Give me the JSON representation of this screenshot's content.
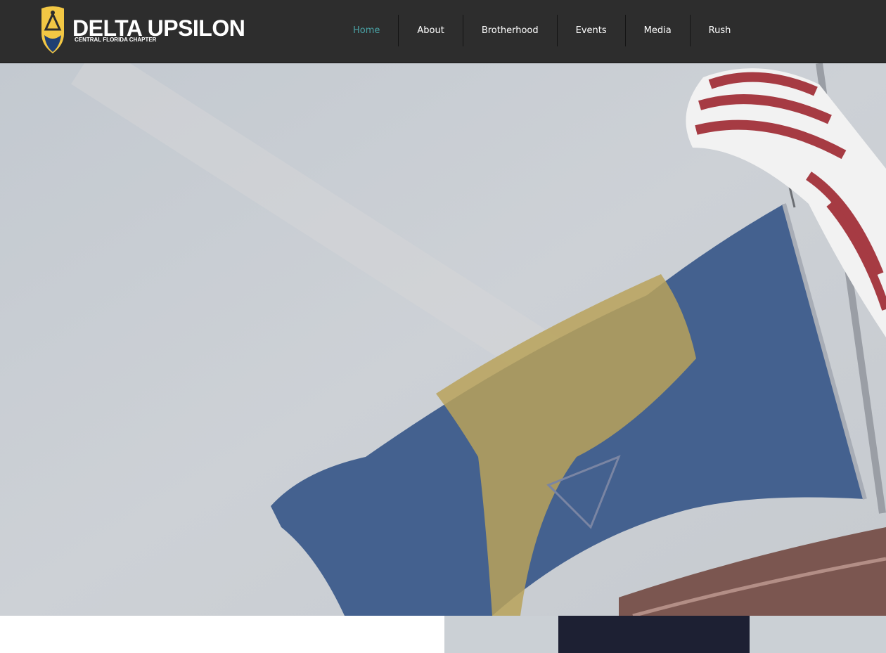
{
  "brand": {
    "name": "DELTA UPSILON",
    "chapter": "CENTRAL FLORIDA CHAPTER"
  },
  "nav": {
    "items": [
      {
        "label": "Home",
        "active": true
      },
      {
        "label": "About",
        "active": false
      },
      {
        "label": "Brotherhood",
        "active": false
      },
      {
        "label": "Events",
        "active": false
      },
      {
        "label": "Media",
        "active": false
      },
      {
        "label": "Rush",
        "active": false
      }
    ]
  },
  "colors": {
    "header_bg": "#2d2d2d",
    "nav_active": "#4aa3a6",
    "nav_text": "#ffffff",
    "flag_blue": "#44618f",
    "flag_gold": "#b9a25a"
  }
}
